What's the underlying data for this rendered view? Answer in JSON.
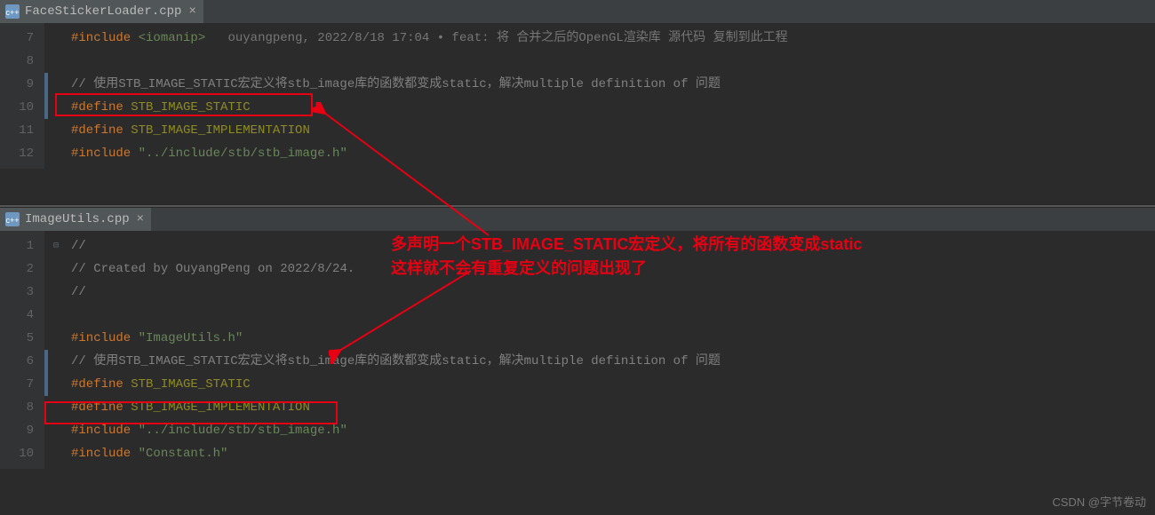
{
  "top_pane": {
    "tab": {
      "filename": "FaceStickerLoader.cpp",
      "close": "×"
    },
    "gutter": [
      "7",
      "8",
      "9",
      "10",
      "11",
      "12"
    ],
    "vcs": {
      "author": "ouyangpeng,",
      "date": "2022/8/18 17:04",
      "dot": "•",
      "msg_prefix": "feat:",
      "msg": "将 合并之后的OpenGL渲染库 源代码 复制到此工程"
    },
    "lines": {
      "l7_include": "#include",
      "l7_path": "<iomanip>",
      "l9_comment": "// 使用STB_IMAGE_STATIC宏定义将stb_image库的函数都变成static，解决multiple definition of 问题",
      "l10_define": "#define",
      "l10_macro": "STB_IMAGE_STATIC",
      "l11_define": "#define",
      "l11_macro": "STB_IMAGE_IMPLEMENTATION",
      "l12_include": "#include",
      "l12_path": "\"../include/stb/stb_image.h\""
    }
  },
  "bottom_pane": {
    "tab": {
      "filename": "ImageUtils.cpp",
      "close": "×"
    },
    "gutter": [
      "1",
      "2",
      "3",
      "4",
      "5",
      "6",
      "7",
      "8",
      "9",
      "10"
    ],
    "lines": {
      "l1": "//",
      "l2": "// Created by OuyangPeng on 2022/8/24.",
      "l3": "//",
      "l5_include": "#include",
      "l5_path": "\"ImageUtils.h\"",
      "l6_comment": "// 使用STB_IMAGE_STATIC宏定义将stb_image库的函数都变成static，解决multiple definition of 问题",
      "l7_define": "#define",
      "l7_macro": "STB_IMAGE_STATIC",
      "l8_define": "#define",
      "l8_macro": "STB_IMAGE_IMPLEMENTATION",
      "l9_include": "#include",
      "l9_path": "\"../include/stb/stb_image.h\"",
      "l10_include": "#include",
      "l10_path": "\"Constant.h\""
    }
  },
  "annotation": {
    "line1_a": "多声明一个",
    "line1_b": "STB_IMAGE_STATIC",
    "line1_c": "宏定义，将所有的函数变成",
    "line1_d": "static",
    "line2": "这样就不会有重复定义的问题出现了"
  },
  "watermark": "CSDN @字节卷动"
}
